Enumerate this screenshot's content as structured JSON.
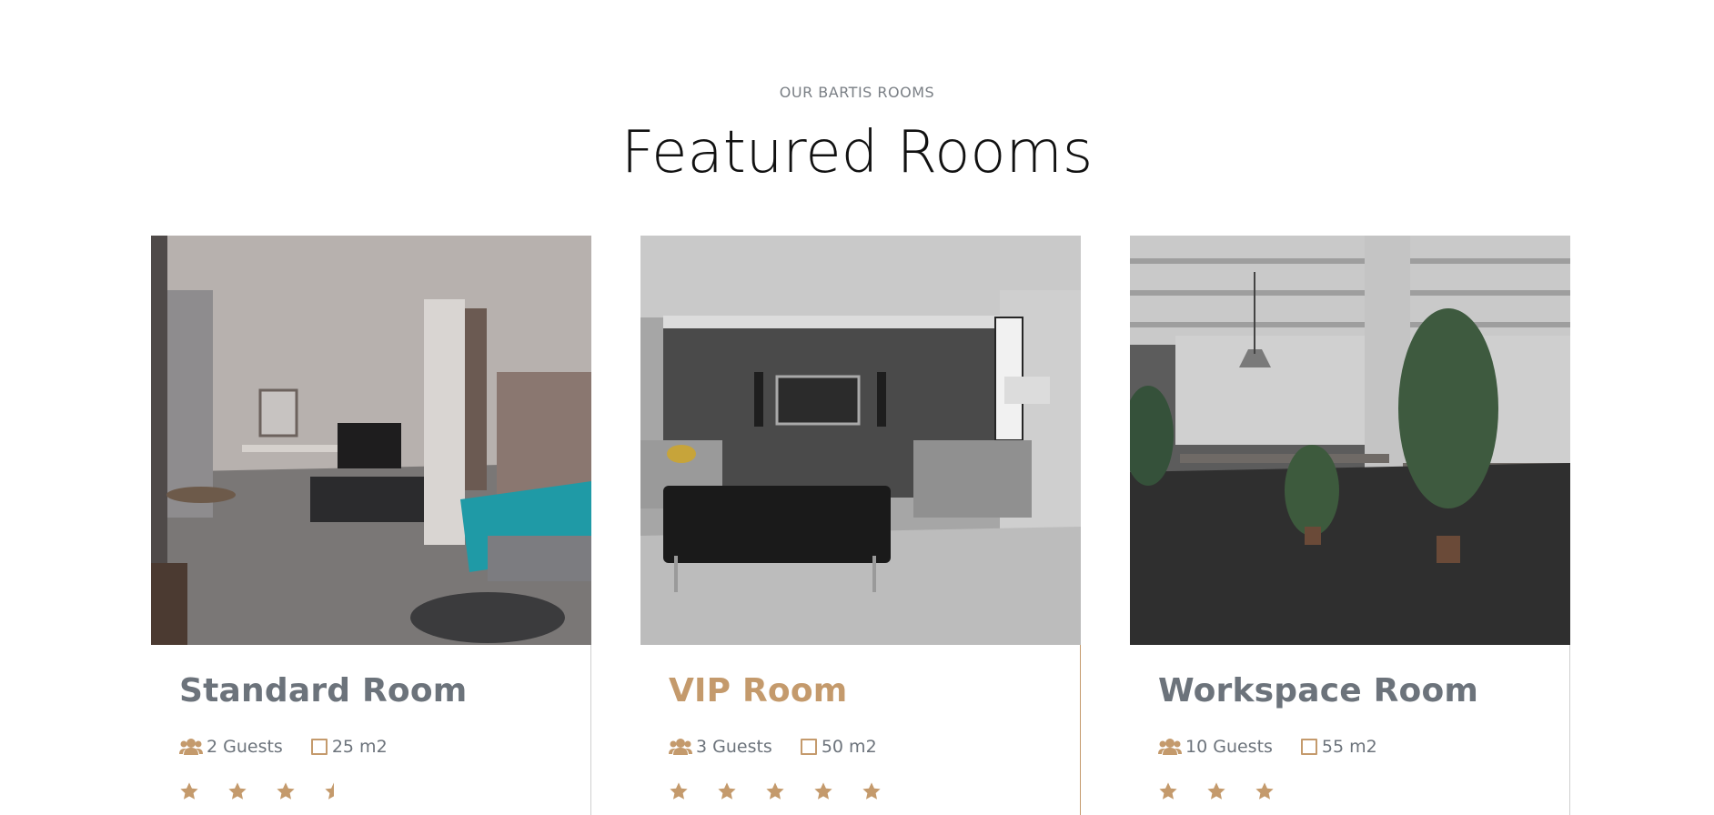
{
  "section": {
    "eyebrow": "OUR BARTIS ROOMS",
    "title": "Featured Rooms"
  },
  "accent_color": "#c49a6c",
  "text_color": "#6c737b",
  "rooms": [
    {
      "name": "Standard Room",
      "guests": "2 Guests",
      "size": "25 m2",
      "rating": 3.5,
      "photo": "bedroom-photo",
      "active": false
    },
    {
      "name": "VIP Room",
      "guests": "3 Guests",
      "size": "50 m2",
      "rating": 5,
      "photo": "living-room-photo",
      "active": true
    },
    {
      "name": "Workspace Room",
      "guests": "10 Guests",
      "size": "55 m2",
      "rating": 3,
      "photo": "office-photo",
      "active": false
    }
  ]
}
